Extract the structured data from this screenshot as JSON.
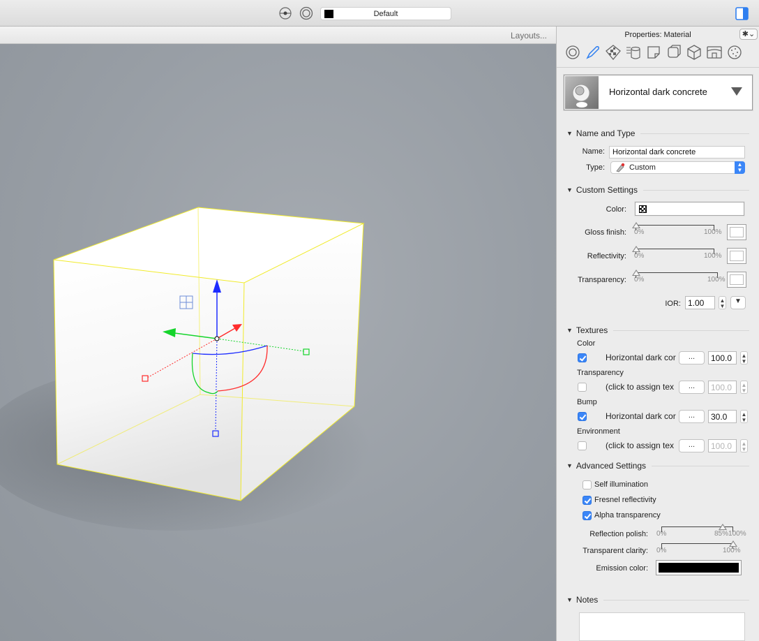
{
  "toolbar": {
    "layer_name": "Default",
    "layer_color": "#000000",
    "icons": [
      "origin-point-icon",
      "snap-target-icon",
      "panel-toggle-icon"
    ]
  },
  "viewport": {
    "layouts_label": "Layouts...",
    "background": "#9aa0a6",
    "object_edge_color": "#f5f000"
  },
  "panel": {
    "title": "Properties: Material",
    "gear_label": "✱⌄",
    "tab_icons": [
      "object-tab-icon",
      "material-tab-icon",
      "texture-tab-icon",
      "database-tab-icon",
      "sticky-note-tab-icon",
      "shadow-box-tab-icon",
      "cube-tab-icon",
      "environment-tab-icon",
      "globe-tab-icon"
    ],
    "material": {
      "name": "Horizontal dark concrete"
    },
    "name_and_type": {
      "header": "Name and Type",
      "name_label": "Name:",
      "name_value": "Horizontal dark concrete",
      "type_label": "Type:",
      "type_value": "Custom"
    },
    "custom_settings": {
      "header": "Custom Settings",
      "color_label": "Color:",
      "gloss_label": "Gloss finish:",
      "gloss_value": 0,
      "reflectivity_label": "Reflectivity:",
      "reflectivity_value": 0,
      "transparency_label": "Transparency:",
      "transparency_value": 0,
      "slider_min": "0%",
      "slider_max": "100%",
      "ior_label": "IOR:",
      "ior_value": "1.00"
    },
    "textures": {
      "header": "Textures",
      "ellipsis": "...",
      "items": [
        {
          "category": "Color",
          "checked": true,
          "name": "Horizontal dark cor",
          "value": "100.0",
          "enabled": true
        },
        {
          "category": "Transparency",
          "checked": false,
          "name": "(click to assign tex",
          "value": "100.0",
          "enabled": false
        },
        {
          "category": "Bump",
          "checked": true,
          "name": "Horizontal dark cor",
          "value": "30.0",
          "enabled": true
        },
        {
          "category": "Environment",
          "checked": false,
          "name": "(click to assign tex",
          "value": "100.0",
          "enabled": false
        }
      ]
    },
    "advanced": {
      "header": "Advanced Settings",
      "self_illumination": "Self illumination",
      "self_illumination_checked": false,
      "fresnel": "Fresnel reflectivity",
      "fresnel_checked": true,
      "alpha": "Alpha transparency",
      "alpha_checked": true,
      "reflection_polish_label": "Reflection polish:",
      "reflection_polish_value": 85,
      "reflection_polish_min": "0%",
      "reflection_polish_max": "85%100%",
      "transparent_clarity_label": "Transparent clarity:",
      "transparent_clarity_value": 100,
      "transparent_clarity_min": "0%",
      "transparent_clarity_max": "100%",
      "emission_label": "Emission color:",
      "emission_color": "#000000"
    },
    "notes": {
      "header": "Notes",
      "value": ""
    }
  }
}
